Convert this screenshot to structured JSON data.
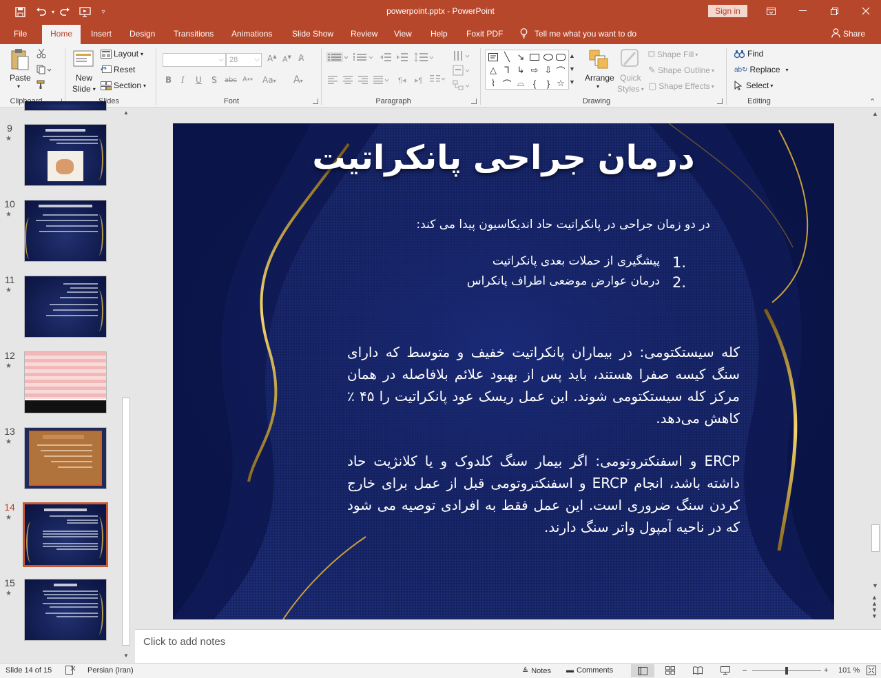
{
  "window": {
    "doc_title": "powerpoint.pptx  -  PowerPoint",
    "sign_in": "Sign in"
  },
  "tabs": [
    {
      "label": "File"
    },
    {
      "label": "Home"
    },
    {
      "label": "Insert"
    },
    {
      "label": "Design"
    },
    {
      "label": "Transitions"
    },
    {
      "label": "Animations"
    },
    {
      "label": "Slide Show"
    },
    {
      "label": "Review"
    },
    {
      "label": "View"
    },
    {
      "label": "Help"
    },
    {
      "label": "Foxit PDF"
    }
  ],
  "tell_me": "Tell me what you want to do",
  "share": "Share",
  "ribbon": {
    "clipboard": {
      "paste": "Paste",
      "label": "Clipboard"
    },
    "slides": {
      "new_slide_1": "New",
      "new_slide_2": "Slide",
      "layout": "Layout",
      "reset": "Reset",
      "section": "Section",
      "label": "Slides"
    },
    "font": {
      "size": "28",
      "label": "Font",
      "bold": "B",
      "italic": "I",
      "underline": "U",
      "shadow": "S",
      "strike": "abc",
      "aa": "Aa",
      "a": "A"
    },
    "paragraph": {
      "label": "Paragraph"
    },
    "drawing": {
      "arrange": "Arrange",
      "quick_styles_1": "Quick",
      "quick_styles_2": "Styles",
      "shape_fill": "Shape Fill",
      "shape_outline": "Shape Outline",
      "shape_effects": "Shape Effects",
      "label": "Drawing"
    },
    "editing": {
      "find": "Find",
      "replace": "Replace",
      "select": "Select",
      "label": "Editing"
    }
  },
  "thumbnails": [
    {
      "num": "9"
    },
    {
      "num": "10"
    },
    {
      "num": "11"
    },
    {
      "num": "12"
    },
    {
      "num": "13"
    },
    {
      "num": "14"
    },
    {
      "num": "15"
    }
  ],
  "slide": {
    "title": "درمان جراحی پانکراتیت",
    "intro": "در دو زمان جراحی در پانکراتیت حاد اندیکاسیون پیدا می کند:",
    "list": [
      {
        "n": "1.",
        "text": "پیشگیری از حملات بعدی پانکراتیت"
      },
      {
        "n": "2.",
        "text": "درمان عوارض موضعی اطراف پانکراس"
      }
    ],
    "para1": "کله سیستکتومی: در بیماران پانکراتیت خفیف و متوسط که دارای سنگ کیسه صفرا هستند، باید پس از بهبود علائم بلافاصله در همان مرکز کله سیستکتومی شوند. این عمل ریسک عود پانکراتیت را ۴۵ ٪ کاهش می‌دهد.",
    "para2": "ERCP و اسفنکتروتومی: اگر بیمار سنگ کلدوک و یا کلانژیت حاد داشته باشد، انجام ERCP و اسفنکتروتومی قبل از عمل برای خارج کردن سنگ ضروری است. این عمل فقط به افرادی توصیه می شود که در ناحیه آمپول واتر سنگ دارند."
  },
  "notes_placeholder": "Click to add notes",
  "status": {
    "slide_of": "Slide 14 of 15",
    "language": "Persian (Iran)",
    "notes": "Notes",
    "comments": "Comments",
    "zoom": "101 %"
  },
  "colors": {
    "accent": "#b7472a",
    "slide_bg": "#0e1850",
    "gold": "#d4a93c"
  }
}
